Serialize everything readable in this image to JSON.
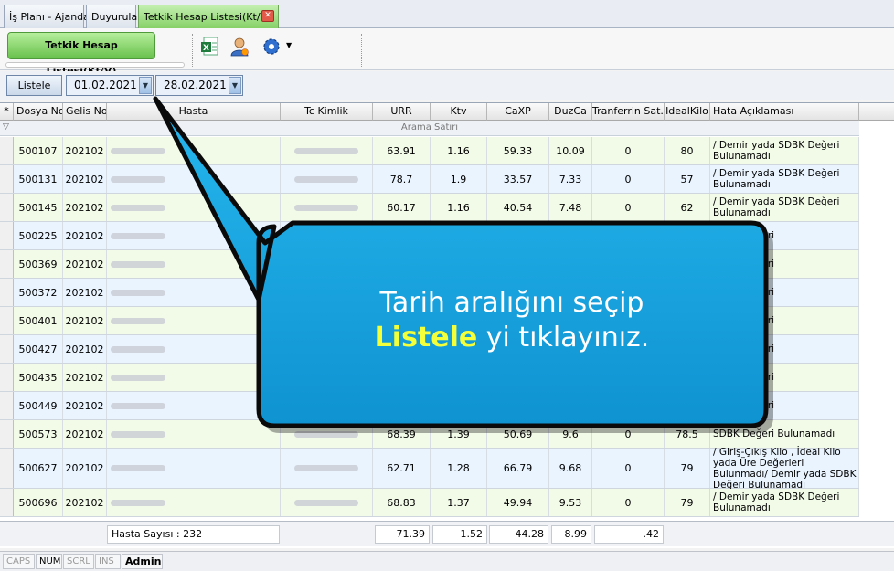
{
  "tabs": [
    {
      "label": "İş Planı - Ajanda"
    },
    {
      "label": "Duyurular"
    },
    {
      "label": "Tetkik Hesap Listesi(Kt/V)"
    }
  ],
  "ribbon": {
    "main_button": "Tetkik Hesap Listesi(Kt/V)",
    "icons": [
      "excel-export-icon",
      "user-icon",
      "settings-gear-icon"
    ]
  },
  "filter": {
    "list_button": "Listele",
    "start_date": "01.02.2021",
    "end_date": "28.02.2021"
  },
  "grid": {
    "columns": [
      "Dosya No",
      "Gelis No",
      "Hasta",
      "Tc Kimlik",
      "URR",
      "Ktv",
      "CaXP",
      "DuzCa",
      "Tranferrin Sat.",
      "IdealKilo",
      "Hata Açıklaması"
    ],
    "search_row_label": "Arama Satırı",
    "rows": [
      {
        "dosya": "500107",
        "gelis": "202102",
        "urr": "63.91",
        "ktv": "1.16",
        "caxp": "59.33",
        "duzca": "10.09",
        "tsat": "0",
        "ideal": "80",
        "hata": "/ Demir yada SDBK Değeri Bulunamadı"
      },
      {
        "dosya": "500131",
        "gelis": "202102",
        "urr": "78.7",
        "ktv": "1.9",
        "caxp": "33.57",
        "duzca": "7.33",
        "tsat": "0",
        "ideal": "57",
        "hata": "/ Demir yada SDBK Değeri Bulunamadı"
      },
      {
        "dosya": "500145",
        "gelis": "202102",
        "urr": "60.17",
        "ktv": "1.16",
        "caxp": "40.54",
        "duzca": "7.48",
        "tsat": "0",
        "ideal": "62",
        "hata": "/ Demir yada SDBK Değeri Bulunamadı"
      },
      {
        "dosya": "500225",
        "gelis": "202102",
        "urr": "",
        "ktv": "",
        "caxp": "",
        "duzca": "",
        "tsat": "",
        "ideal": "",
        "hata": "SDBK Değeri"
      },
      {
        "dosya": "500369",
        "gelis": "202102",
        "urr": "",
        "ktv": "",
        "caxp": "",
        "duzca": "",
        "tsat": "",
        "ideal": "",
        "hata": "SDBK Değeri"
      },
      {
        "dosya": "500372",
        "gelis": "202102",
        "urr": "",
        "ktv": "",
        "caxp": "",
        "duzca": "",
        "tsat": "",
        "ideal": "",
        "hata": "SDBK Değeri"
      },
      {
        "dosya": "500401",
        "gelis": "202102",
        "urr": "",
        "ktv": "",
        "caxp": "",
        "duzca": "",
        "tsat": "",
        "ideal": "",
        "hata": "SDBK Değeri"
      },
      {
        "dosya": "500427",
        "gelis": "202102",
        "urr": "",
        "ktv": "",
        "caxp": "",
        "duzca": "",
        "tsat": "",
        "ideal": "",
        "hata": "SDBK Değeri"
      },
      {
        "dosya": "500435",
        "gelis": "202102",
        "urr": "",
        "ktv": "",
        "caxp": "",
        "duzca": "",
        "tsat": "",
        "ideal": "",
        "hata": "SDBK Değeri"
      },
      {
        "dosya": "500449",
        "gelis": "202102",
        "urr": "",
        "ktv": "",
        "caxp": "",
        "duzca": "",
        "tsat": "",
        "ideal": "",
        "hata": "SDBK Değeri"
      },
      {
        "dosya": "500573",
        "gelis": "202102",
        "urr": "68.39",
        "ktv": "1.39",
        "caxp": "50.69",
        "duzca": "9.6",
        "tsat": "0",
        "ideal": "78.5",
        "hata": "SDBK Değeri Bulunamadı"
      },
      {
        "dosya": "500627",
        "gelis": "202102",
        "urr": "62.71",
        "ktv": "1.28",
        "caxp": "66.79",
        "duzca": "9.68",
        "tsat": "0",
        "ideal": "79",
        "hata": "/ Giriş-Çıkış Kilo , İdeal Kilo yada Üre Değerleri Bulunmadı/ Demir yada SDBK Değeri Bulunamadı"
      },
      {
        "dosya": "500696",
        "gelis": "202102",
        "urr": "68.83",
        "ktv": "1.37",
        "caxp": "49.94",
        "duzca": "9.53",
        "tsat": "0",
        "ideal": "79",
        "hata": "/ Demir yada SDBK Değeri Bulunamadı"
      }
    ],
    "footer": {
      "hasta_sayisi": "Hasta Sayısı : 232",
      "urr": "71.39",
      "ktv": "1.52",
      "caxp": "44.28",
      "duzca": "8.99",
      "tsat": ".42"
    }
  },
  "callout": {
    "line1": "Tarih aralığını seçip",
    "highlight": "Listele",
    "line2_rest": " yi tıklayınız."
  },
  "statusbar": {
    "caps": "CAPS",
    "num": "NUM",
    "scrl": "SCRL",
    "ins": "INS",
    "user": "Admin"
  }
}
